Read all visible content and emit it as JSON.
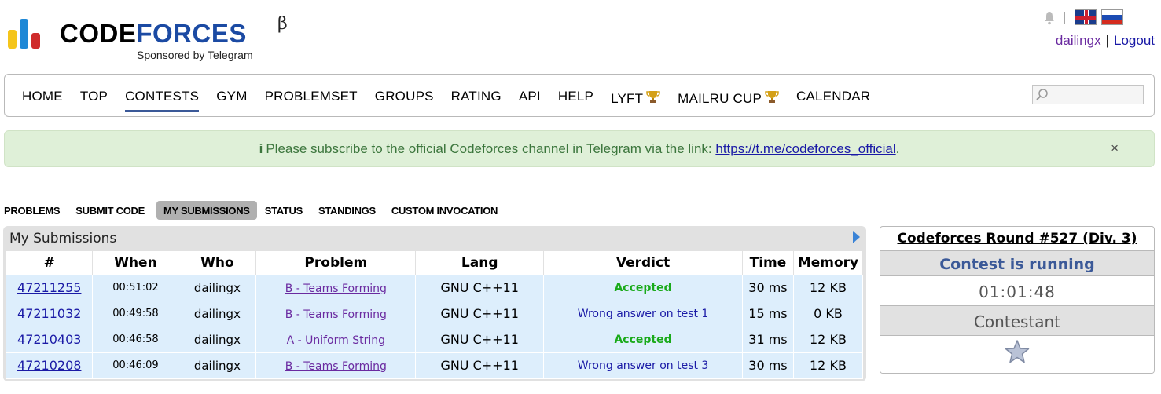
{
  "header": {
    "logo_code": "CODE",
    "logo_forces": "FORCES",
    "logo_beta": "β",
    "sponsor": "Sponsored by Telegram",
    "username": "dailingx",
    "logout": "Logout"
  },
  "nav": {
    "items": [
      "HOME",
      "TOP",
      "CONTESTS",
      "GYM",
      "PROBLEMSET",
      "GROUPS",
      "RATING",
      "API",
      "HELP",
      "LYFT",
      "MAILRU CUP",
      "CALENDAR"
    ],
    "active": "CONTESTS"
  },
  "alert": {
    "icon": "i",
    "text": "Please subscribe to the official Codeforces channel in Telegram via the link: ",
    "link": "https://t.me/codeforces_official",
    "suffix": ".",
    "close": "×"
  },
  "tabs": {
    "items": [
      "PROBLEMS",
      "SUBMIT CODE",
      "MY SUBMISSIONS",
      "STATUS",
      "STANDINGS",
      "CUSTOM INVOCATION"
    ],
    "active": "MY SUBMISSIONS"
  },
  "submissions": {
    "title": "My Submissions",
    "columns": [
      "#",
      "When",
      "Who",
      "Problem",
      "Lang",
      "Verdict",
      "Time",
      "Memory"
    ],
    "rows": [
      {
        "id": "47211255",
        "when": "00:51:02",
        "who": "dailingx",
        "problem": "B - Teams Forming",
        "lang": "GNU C++11",
        "verdict": "Accepted",
        "status": "ok",
        "time": "30 ms",
        "memory": "12 KB"
      },
      {
        "id": "47211032",
        "when": "00:49:58",
        "who": "dailingx",
        "problem": "B - Teams Forming",
        "lang": "GNU C++11",
        "verdict": "Wrong answer on test 1",
        "status": "wa",
        "time": "15 ms",
        "memory": "0 KB"
      },
      {
        "id": "47210403",
        "when": "00:46:58",
        "who": "dailingx",
        "problem": "A - Uniform String",
        "lang": "GNU C++11",
        "verdict": "Accepted",
        "status": "ok",
        "time": "31 ms",
        "memory": "12 KB"
      },
      {
        "id": "47210208",
        "when": "00:46:09",
        "who": "dailingx",
        "problem": "B - Teams Forming",
        "lang": "GNU C++11",
        "verdict": "Wrong answer on test 3",
        "status": "wa",
        "time": "30 ms",
        "memory": "12 KB"
      }
    ]
  },
  "sidebar": {
    "contest_title": "Codeforces Round #527 (Div. 3)",
    "status": "Contest is running",
    "timer": "01:01:48",
    "role": "Contestant"
  },
  "colors": {
    "accent": "#3b5998",
    "accepted": "#1aaa1a",
    "link": "#1a1aa6",
    "row_bg": "#ddeefc",
    "alert_bg": "#dff0d8"
  }
}
